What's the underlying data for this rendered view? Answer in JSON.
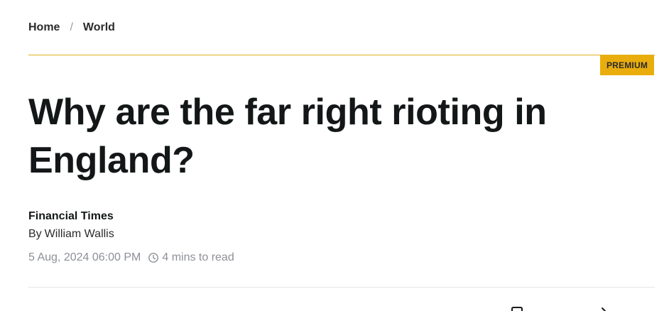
{
  "breadcrumb": {
    "items": [
      "Home",
      "World"
    ],
    "separator": "/"
  },
  "badge": {
    "label": "PREMIUM",
    "color": "#e9ad0d"
  },
  "article": {
    "headline": "Why are the far right rioting in England?",
    "source": "Financial Times",
    "byline_prefix": "By",
    "author": "William Wallis",
    "date": "5 Aug, 2024 06:00 PM",
    "read_time": "4 mins to read"
  },
  "icons": {
    "clock": "clock-icon",
    "bookmark": "bookmark-icon",
    "share": "share-icon"
  },
  "colors": {
    "accent_rule": "#e0b21d",
    "text": "#141718",
    "muted": "#8d9096"
  }
}
